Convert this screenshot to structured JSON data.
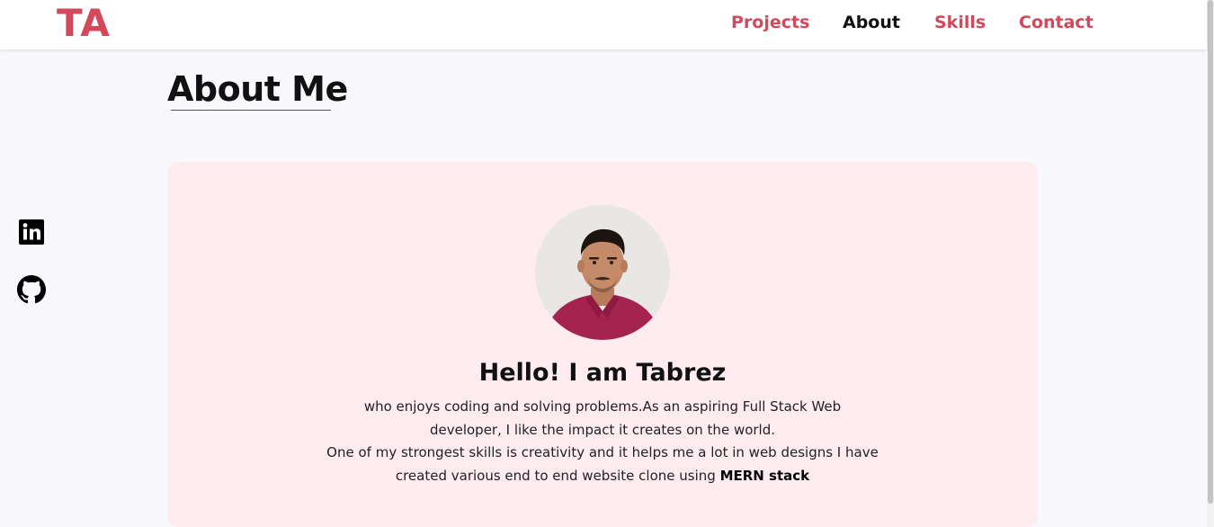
{
  "navbar": {
    "logo": "TA",
    "links": [
      {
        "label": "Projects",
        "active": false
      },
      {
        "label": "About",
        "active": true
      },
      {
        "label": "Skills",
        "active": false
      },
      {
        "label": "Contact",
        "active": false
      }
    ]
  },
  "about": {
    "title": "About Me",
    "greeting": "Hello! I am Tabrez",
    "paragraph1": "who enjoys coding and solving problems.As an aspiring Full Stack Web developer, I like the impact it creates on the world.",
    "paragraph2_prefix": "One of my strongest skills is creativity and it helps me a lot in web designs I have created various end to end website clone using ",
    "paragraph2_bold": "MERN stack"
  },
  "social": {
    "icons": [
      "linkedin-icon",
      "github-icon"
    ]
  },
  "colors": {
    "accent": "#d1495b",
    "page_bg": "#f9f8fd",
    "card_bg": "#ffecf1",
    "text": "#111111"
  }
}
